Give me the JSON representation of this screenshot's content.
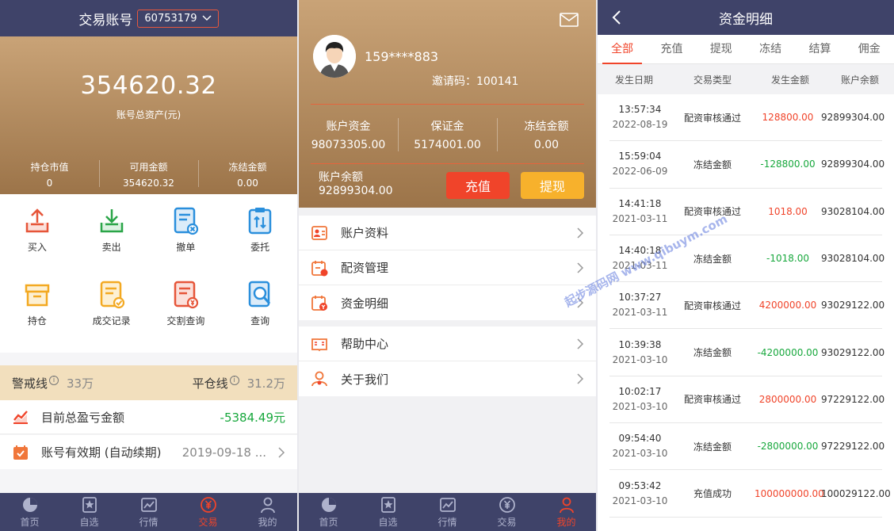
{
  "colors": {
    "navy": "#3f4369",
    "gold_top": "#c9a377",
    "gold_bottom": "#9c7449",
    "red": "#f0442a",
    "yellow": "#f7b12c",
    "green": "#18a83d"
  },
  "tabbar": {
    "items": [
      "首页",
      "自选",
      "行情",
      "交易",
      "我的"
    ]
  },
  "panel1": {
    "header_title": "交易账号",
    "account_id": "60753179",
    "total_assets": "354620.32",
    "total_assets_label": "账号总资产(元)",
    "stats": [
      {
        "label": "持仓市值",
        "value": "0"
      },
      {
        "label": "可用金额",
        "value": "354620.32"
      },
      {
        "label": "冻结金额",
        "value": "0.00"
      }
    ],
    "grid": [
      {
        "label": "买入",
        "icon": "buy-icon"
      },
      {
        "label": "卖出",
        "icon": "sell-icon"
      },
      {
        "label": "撤单",
        "icon": "cancel-order-icon"
      },
      {
        "label": "委托",
        "icon": "entrust-icon"
      },
      {
        "label": "持仓",
        "icon": "position-icon"
      },
      {
        "label": "成交记录",
        "icon": "deal-record-icon"
      },
      {
        "label": "交割查询",
        "icon": "settlement-query-icon"
      },
      {
        "label": "查询",
        "icon": "query-icon"
      }
    ],
    "warning_label": "警戒线",
    "warning_value": "33万",
    "liquidation_label": "平仓线",
    "liquidation_value": "31.2万",
    "pnl_label": "目前总盈亏金额",
    "pnl_value": "-5384.49元",
    "expiry_label": "账号有效期 (自动续期)",
    "expiry_value": "2019-09-18 ..."
  },
  "panel2": {
    "phone": "159****883",
    "invite_label": "邀请码：",
    "invite_code": "100141",
    "stats": [
      {
        "label": "账户资金",
        "value": "98073305.00"
      },
      {
        "label": "保证金",
        "value": "5174001.00"
      },
      {
        "label": "冻结金额",
        "value": "0.00"
      }
    ],
    "balance_label": "账户余额",
    "balance_value": "92899304.00",
    "deposit_button": "充值",
    "withdraw_button": "提现",
    "menu1": [
      {
        "label": "账户资料",
        "icon": "account-profile-icon"
      },
      {
        "label": "配资管理",
        "icon": "margin-management-icon"
      },
      {
        "label": "资金明细",
        "icon": "fund-detail-icon"
      }
    ],
    "menu2": [
      {
        "label": "帮助中心",
        "icon": "help-center-icon"
      },
      {
        "label": "关于我们",
        "icon": "about-us-icon"
      }
    ]
  },
  "panel3": {
    "title": "资金明细",
    "tabs": [
      "全部",
      "充值",
      "提现",
      "冻结",
      "结算",
      "佣金"
    ],
    "active_tab": 0,
    "columns": [
      "发生日期",
      "交易类型",
      "发生金额",
      "账户余额"
    ],
    "rows": [
      {
        "time": "13:57:34",
        "date": "2022-08-19",
        "type": "配资审核通过",
        "amount": "128800.00",
        "sign": "pos",
        "balance": "92899304.00"
      },
      {
        "time": "15:59:04",
        "date": "2022-06-09",
        "type": "冻结金额",
        "amount": "-128800.00",
        "sign": "neg",
        "balance": "92899304.00"
      },
      {
        "time": "14:41:18",
        "date": "2021-03-11",
        "type": "配资审核通过",
        "amount": "1018.00",
        "sign": "pos",
        "balance": "93028104.00"
      },
      {
        "time": "14:40:18",
        "date": "2021-03-11",
        "type": "冻结金额",
        "amount": "-1018.00",
        "sign": "neg",
        "balance": "93028104.00"
      },
      {
        "time": "10:37:27",
        "date": "2021-03-11",
        "type": "配资审核通过",
        "amount": "4200000.00",
        "sign": "pos",
        "balance": "93029122.00"
      },
      {
        "time": "10:39:38",
        "date": "2021-03-10",
        "type": "冻结金额",
        "amount": "-4200000.00",
        "sign": "neg",
        "balance": "93029122.00"
      },
      {
        "time": "10:02:17",
        "date": "2021-03-10",
        "type": "配资审核通过",
        "amount": "2800000.00",
        "sign": "pos",
        "balance": "97229122.00"
      },
      {
        "time": "09:54:40",
        "date": "2021-03-10",
        "type": "冻结金额",
        "amount": "-2800000.00",
        "sign": "neg",
        "balance": "97229122.00"
      },
      {
        "time": "09:53:42",
        "date": "2021-03-10",
        "type": "充值成功",
        "amount": "100000000.00",
        "sign": "pos",
        "balance": "100029122.00"
      }
    ]
  },
  "watermark": "起步源码网 www.qibuym.com"
}
